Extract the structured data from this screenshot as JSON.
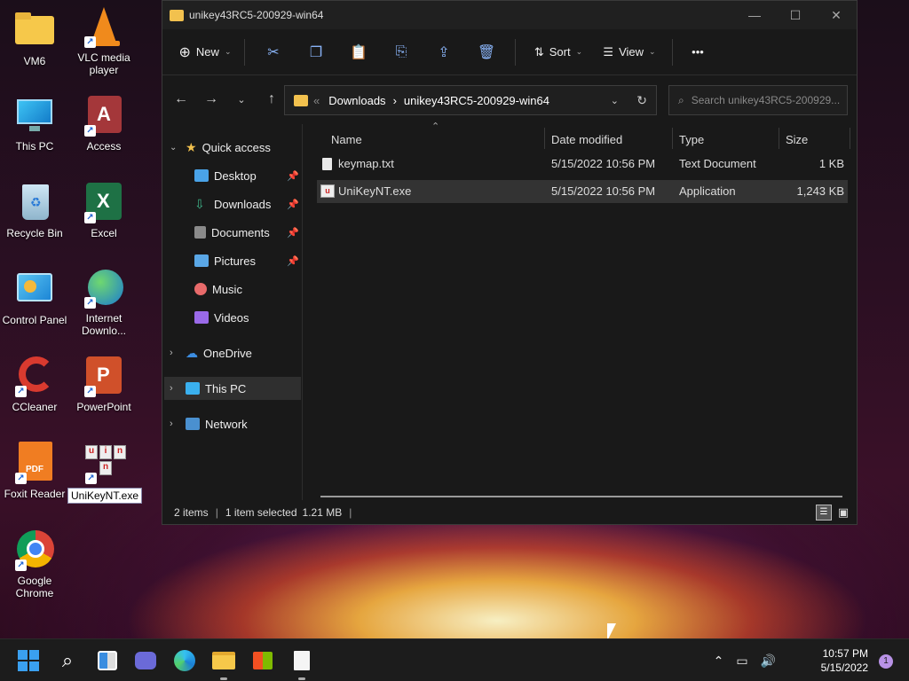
{
  "desktop": {
    "icons": [
      {
        "label": "VM6",
        "icon": "folder-icon"
      },
      {
        "label": "VLC media player",
        "icon": "vlc-icon"
      },
      {
        "label": "This PC",
        "icon": "monitor-icon"
      },
      {
        "label": "Access",
        "icon": "access-icon"
      },
      {
        "label": "Recycle Bin",
        "icon": "recycle-bin-icon"
      },
      {
        "label": "Excel",
        "icon": "excel-icon"
      },
      {
        "label": "Control Panel",
        "icon": "control-panel-icon"
      },
      {
        "label": "Internet Downlo...",
        "icon": "idm-icon"
      },
      {
        "label": "CCleaner",
        "icon": "ccleaner-icon"
      },
      {
        "label": "PowerPoint",
        "icon": "powerpoint-icon"
      },
      {
        "label": "Foxit Reader",
        "icon": "foxit-icon"
      },
      {
        "label": "UniKeyNT.exe",
        "icon": "unikey-icon"
      },
      {
        "label": "Google Chrome",
        "icon": "chrome-icon"
      }
    ]
  },
  "window": {
    "title": "unikey43RC5-200929-win64",
    "controls": {
      "minimize": "—",
      "maximize": "☐",
      "close": "✕"
    }
  },
  "toolbar": {
    "new_label": "New",
    "sort_label": "Sort",
    "view_label": "View",
    "more_label": "•••"
  },
  "address": {
    "overflow": "«",
    "crumbs": [
      "Downloads",
      "unikey43RC5-200929-win64"
    ],
    "separator": "›"
  },
  "search": {
    "placeholder": "Search unikey43RC5-200929..."
  },
  "navpane": {
    "quick_access": "Quick access",
    "items": [
      {
        "label": "Desktop",
        "pinned": true,
        "color": "#4aa3e8"
      },
      {
        "label": "Downloads",
        "pinned": true,
        "color": "#3fb68b"
      },
      {
        "label": "Documents",
        "pinned": true,
        "color": "#8a8a8a"
      },
      {
        "label": "Pictures",
        "pinned": true,
        "color": "#5aa7e6"
      },
      {
        "label": "Music",
        "pinned": false,
        "color": "#e86a6a"
      },
      {
        "label": "Videos",
        "pinned": false,
        "color": "#9a6ae8"
      }
    ],
    "onedrive": "OneDrive",
    "this_pc": "This PC",
    "network": "Network"
  },
  "columns": {
    "name": "Name",
    "date": "Date modified",
    "type": "Type",
    "size": "Size"
  },
  "files": [
    {
      "name": "keymap.txt",
      "date": "5/15/2022 10:56 PM",
      "type": "Text Document",
      "size": "1 KB",
      "selected": false
    },
    {
      "name": "UniKeyNT.exe",
      "date": "5/15/2022 10:56 PM",
      "type": "Application",
      "size": "1,243 KB",
      "selected": true
    }
  ],
  "status": {
    "count": "2 items",
    "selected": "1 item selected",
    "size": "1.21 MB"
  },
  "taskbar": {
    "time": "10:57 PM",
    "date": "5/15/2022",
    "notification_count": "1",
    "apps": [
      "start-icon",
      "search-icon",
      "widgets-icon",
      "chat-icon",
      "edge-icon",
      "file-explorer-icon",
      "store-icon",
      "notepad-icon"
    ]
  }
}
